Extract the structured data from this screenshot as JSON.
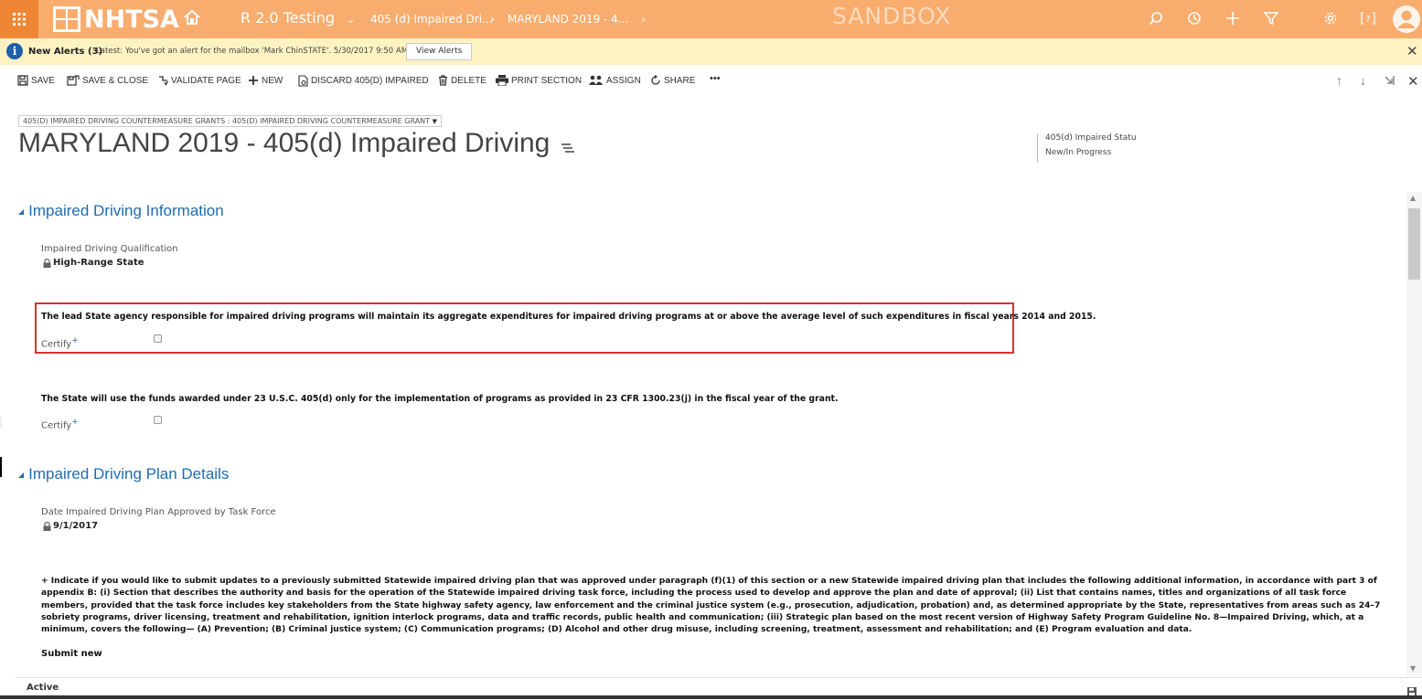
{
  "topbar": {
    "logo_text": "NHTSA",
    "area": "R 2.0 Testing",
    "crumbs": [
      "405 (d) Impaired Dri...",
      "MARYLAND 2019 - 4..."
    ],
    "environment": "SANDBOX",
    "colors": {
      "bar": "#f8ad6f",
      "waffle": "#ee8636"
    }
  },
  "alert": {
    "title": "New Alerts (3)",
    "message": "Latest: You've got an alert for the mailbox 'Mark ChinSTATE'. 5/30/2017 9:50 AM",
    "button": "View Alerts"
  },
  "commands": {
    "save": "SAVE",
    "save_close": "SAVE & CLOSE",
    "validate": "VALIDATE PAGE",
    "new": "NEW",
    "discard": "DISCARD 405(D) IMPAIRED",
    "delete": "DELETE",
    "print": "PRINT SECTION",
    "assign": "ASSIGN",
    "share": "SHARE",
    "more": "•••"
  },
  "record": {
    "entity": "405(D) IMPAIRED DRIVING COUNTERMEASURE GRANTS : 405(D) IMPAIRED DRIVING COUNTERMEASURE GRANT",
    "title": "MARYLAND 2019 - 405(d) Impaired Driving",
    "header_field": {
      "label": "405(d) Impaired Statu",
      "value": "New/In Progress"
    }
  },
  "section1": {
    "title": "Impaired Driving Information",
    "qualification_label": "Impaired Driving Qualification",
    "qualification_value": "High-Range State",
    "statement1": "The lead State agency responsible for impaired driving programs will maintain its aggregate expenditures for impaired driving programs at or above the average level of such expenditures in fiscal years 2014 and 2015.",
    "certify1": "Certify",
    "statement2": "The State will use the funds awarded under 23 U.S.C. 405(d) only for the implementation of programs as provided in 23 CFR 1300.23(j) in the fiscal year of the grant.",
    "certify2": "Certify"
  },
  "section2": {
    "title": "Impaired Driving Plan Details",
    "date_label": "Date Impaired Driving Plan Approved by Task Force",
    "date_value": "9/1/2017",
    "long_text": "+ Indicate if you would like to submit updates to a previously submitted Statewide impaired driving plan that was approved under paragraph (f)(1) of this section or a new Statewide impaired driving plan that includes the following additional information, in accordance with part 3 of appendix B: (i) Section that describes the authority and basis for the operation of the Statewide impaired driving task force, including the process used to develop and approve the plan and date of approval; (ii) List that contains names, titles and organizations of all task force members, provided that the task force includes key stakeholders from the State highway safety agency, law enforcement and the criminal justice system (e.g., prosecution, adjudication, probation) and, as determined appropriate by the State, representatives from areas such as 24–7 sobriety programs, driver licensing, treatment and rehabilitation, ignition interlock programs, data and traffic records, public health and communication; (iii) Strategic plan based on the most recent version of Highway Safety Program Guideline No. 8—Impaired Driving, which, at a minimum, covers the following— (A) Prevention; (B) Criminal justice system; (C) Communication programs; (D) Alcohol and other drug misuse, including screening, treatment, assessment and rehabilitation; and (E) Program evaluation and data.",
    "submit_new": "Submit new"
  },
  "footer": {
    "status": "Active"
  },
  "highlight_color": "#d83234"
}
